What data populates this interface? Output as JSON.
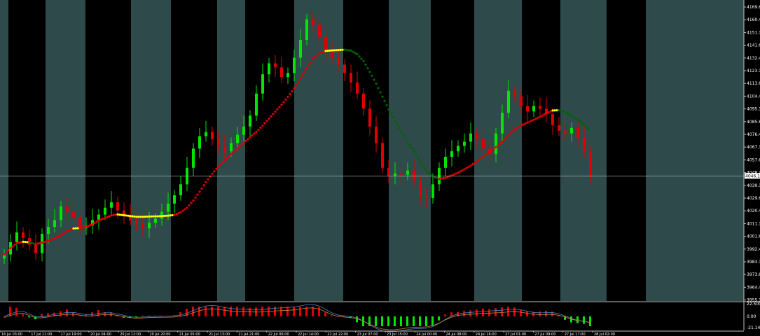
{
  "price_axis": {
    "labels": [
      "4169.65",
      "4160.40",
      "4151.15",
      "4141.65",
      "4132.40",
      "4123.15",
      "4113.65",
      "4104.40",
      "4095.15",
      "4085.65",
      "4076.40",
      "4067.15",
      "4057.65",
      "4048.40",
      "4039.15",
      "4029.65",
      "4020.40",
      "4011.15",
      "4001.65",
      "3992.40",
      "3983.15",
      "3973.65",
      "3964.40",
      "3955.15"
    ],
    "current_price": "4046.12"
  },
  "oscillator_axis": {
    "labels": [
      "22.5009",
      "0.00",
      "-21.1466"
    ]
  },
  "time_axis": {
    "labels": [
      "16 Jul 03:00",
      "17 Jul 11:00",
      "17 Jul 19:00",
      "20 Jul 04:00",
      "20 Jul 12:00",
      "20 Jul 20:00",
      "21 Jul 05:00",
      "21 Jul 13:00",
      "21 Jul 21:00",
      "22 Jul 06:00",
      "22 Jul 14:00",
      "22 Jul 22:00",
      "23 Jul 07:00",
      "23 Jul 15:00",
      "24 Jul 00:00",
      "24 Jul 08:00",
      "24 Jul 16:00",
      "27 Jul 01:00",
      "27 Jul 09:00",
      "27 Jul 17:00",
      "28 Jul 02:00"
    ]
  },
  "colors": {
    "background": "#000000",
    "session_band": "#2e4a4a",
    "bull_candle": "#00e600",
    "bear_candle": "#e00000",
    "ma_up": "#e00000",
    "ma_flat": "#ffff00",
    "ma_down": "#006400",
    "macd_main": "#4a86c8",
    "macd_signal": "#c88a3a",
    "axis_text": "#ffffff",
    "grid_line": "#c0c0c0"
  },
  "chart_data": {
    "type": "candlestick",
    "ylim": [
      3955.15,
      4172
    ],
    "x_labels_shown": "time_axis.labels",
    "candles_close": [
      3989,
      3998,
      4005,
      4001,
      3996,
      3990,
      4004,
      4009,
      4014,
      4024,
      4020,
      4016,
      4008,
      4010,
      4014,
      4018,
      4023,
      4027,
      4021,
      4018,
      4014,
      4011,
      4008,
      4012,
      4015,
      4020,
      4026,
      4032,
      4040,
      4052,
      4066,
      4075,
      4078,
      4073,
      4068,
      4064,
      4070,
      4076,
      4082,
      4090,
      4106,
      4120,
      4128,
      4125,
      4118,
      4121,
      4132,
      4145,
      4160,
      4156,
      4147,
      4138,
      4132,
      4127,
      4121,
      4114,
      4106,
      4095,
      4082,
      4070,
      4052,
      4046,
      4048,
      4047,
      4050,
      4043,
      4031,
      4030,
      4040,
      4052,
      4060,
      4064,
      4068,
      4071,
      4077,
      4073,
      4066,
      4062,
      4077,
      4092,
      4108,
      4104,
      4097,
      4093,
      4097,
      4095,
      4091,
      4083,
      4079,
      4077,
      4081,
      4074,
      4064,
      4045
    ],
    "ma_value_series_note": "moving average colored by slope: red rising, yellow flat, green falling",
    "oscillator_ylim": [
      -21.1466,
      22.5009
    ]
  }
}
